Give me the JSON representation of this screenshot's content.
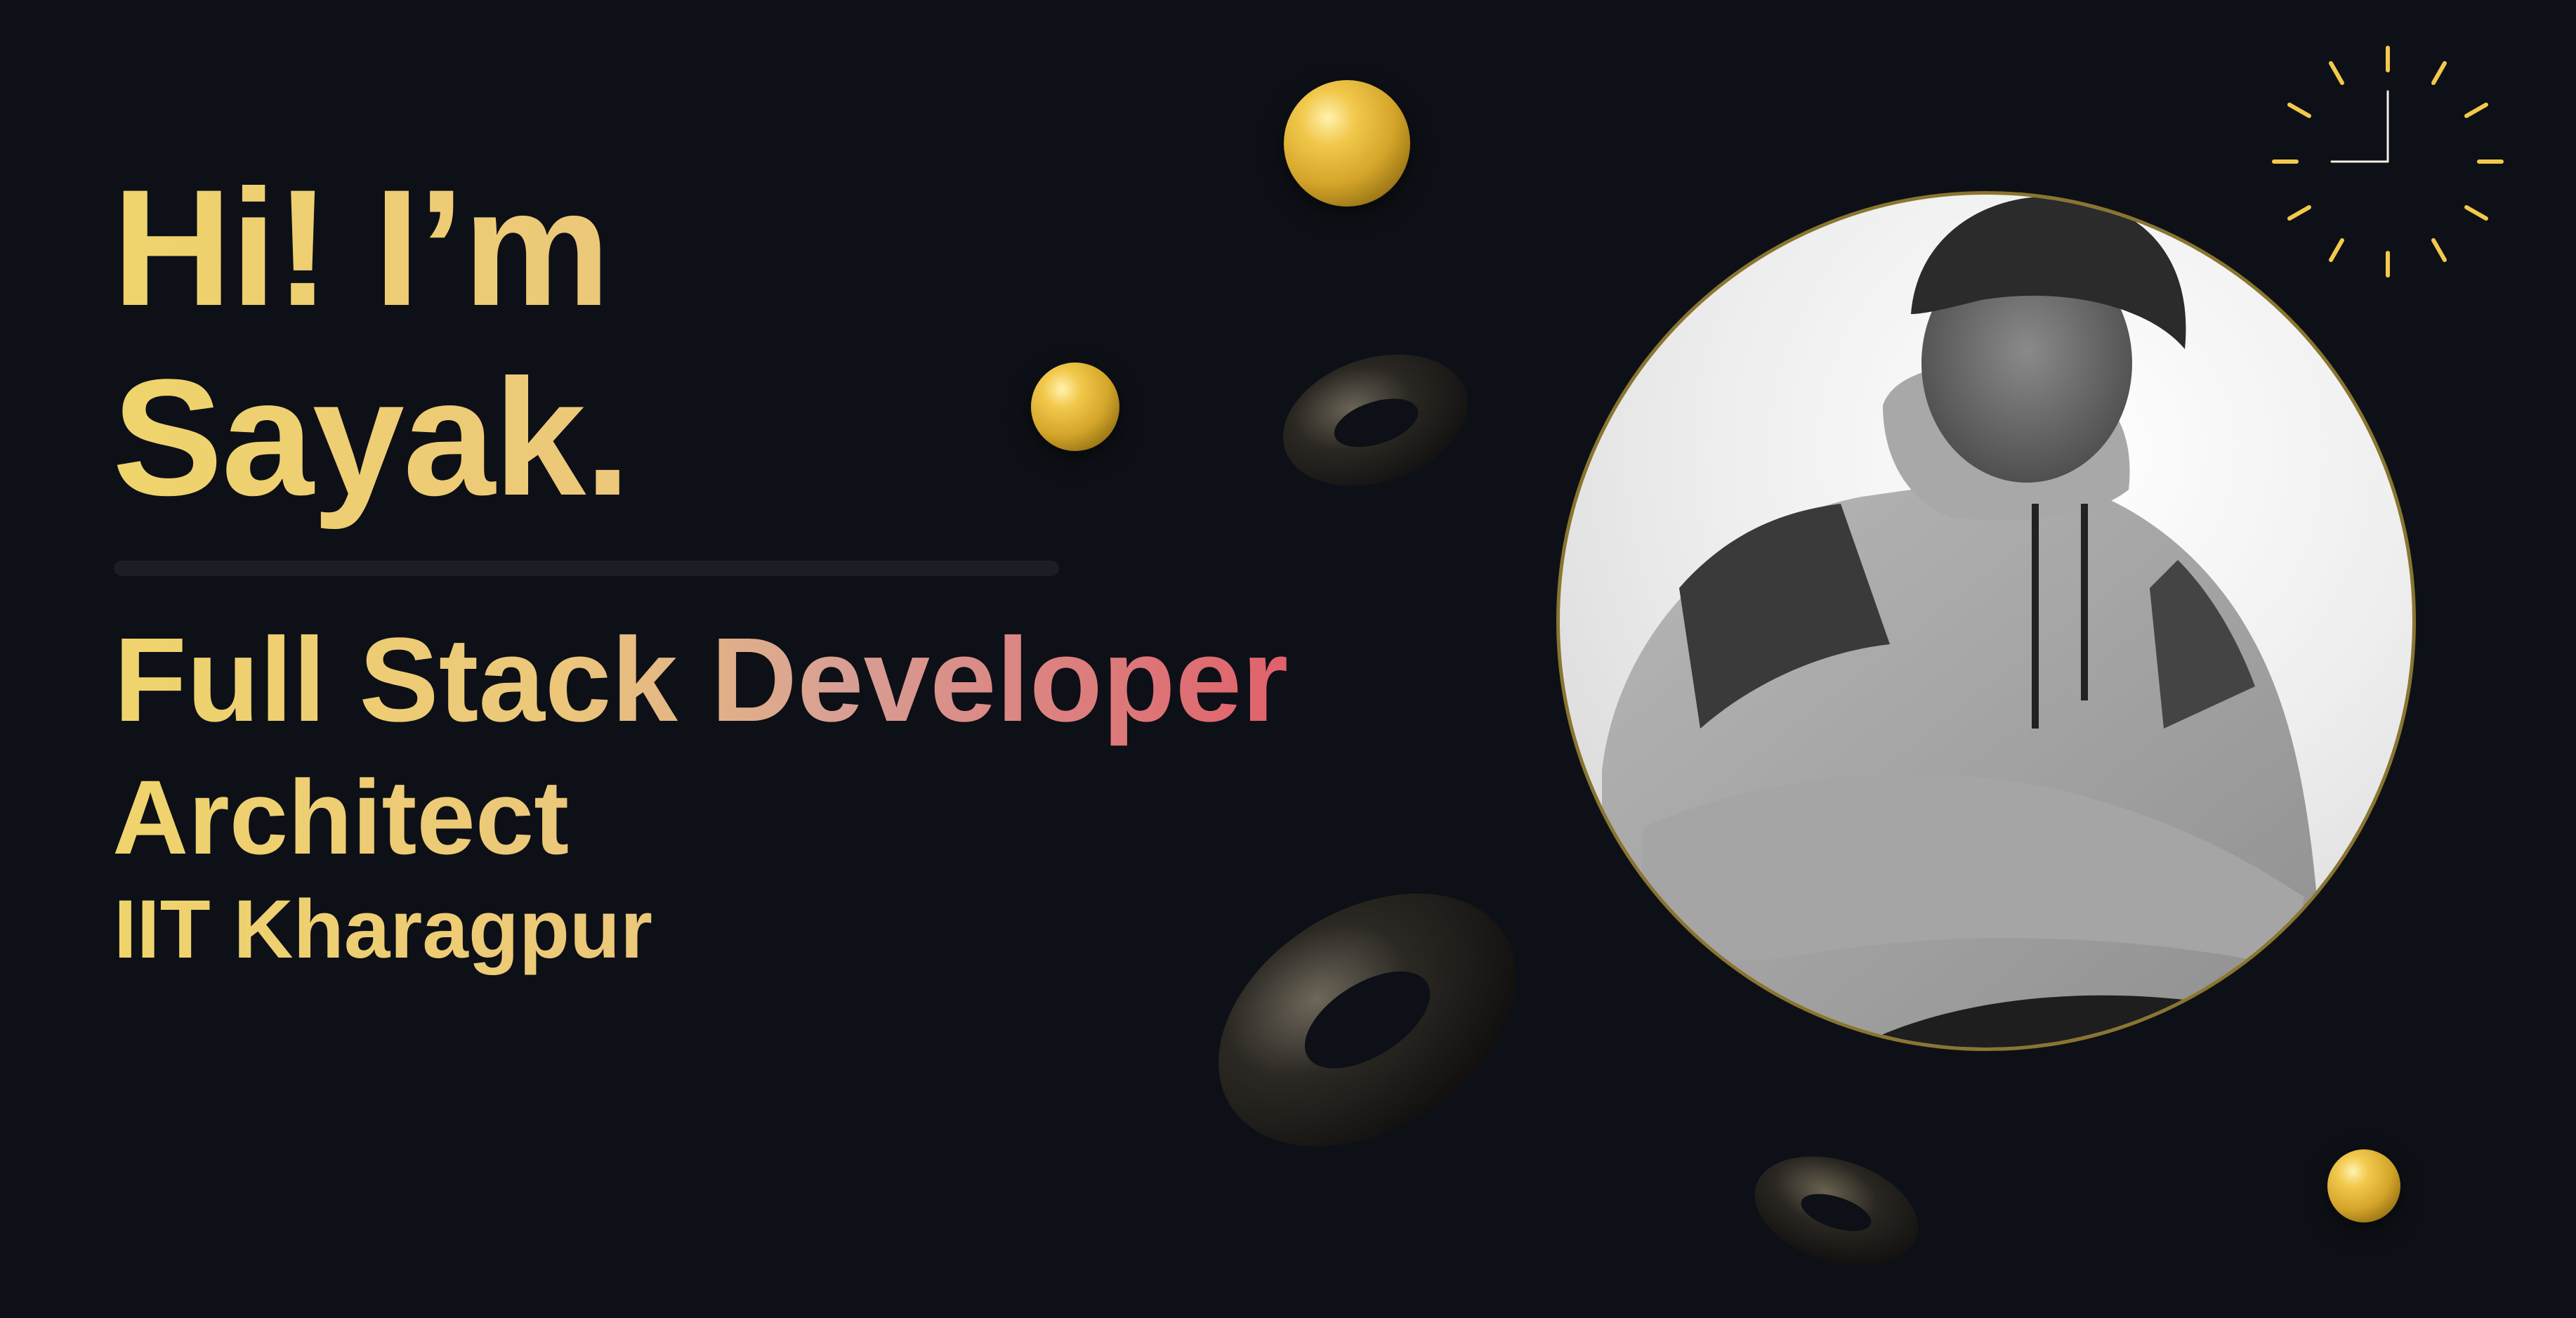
{
  "hero": {
    "greeting_line1": "Hi! I’m",
    "greeting_line2": "Sayak.",
    "role": "Full Stack Developer",
    "title": "Architect",
    "organization": "IIT Kharagpur"
  },
  "colors": {
    "background": "#0d1016",
    "gold": "#efd46c",
    "gradient_end": "#e0616a",
    "clock_accent": "#f2c94c"
  },
  "icons": [
    "clock-icon",
    "sphere",
    "torus"
  ]
}
